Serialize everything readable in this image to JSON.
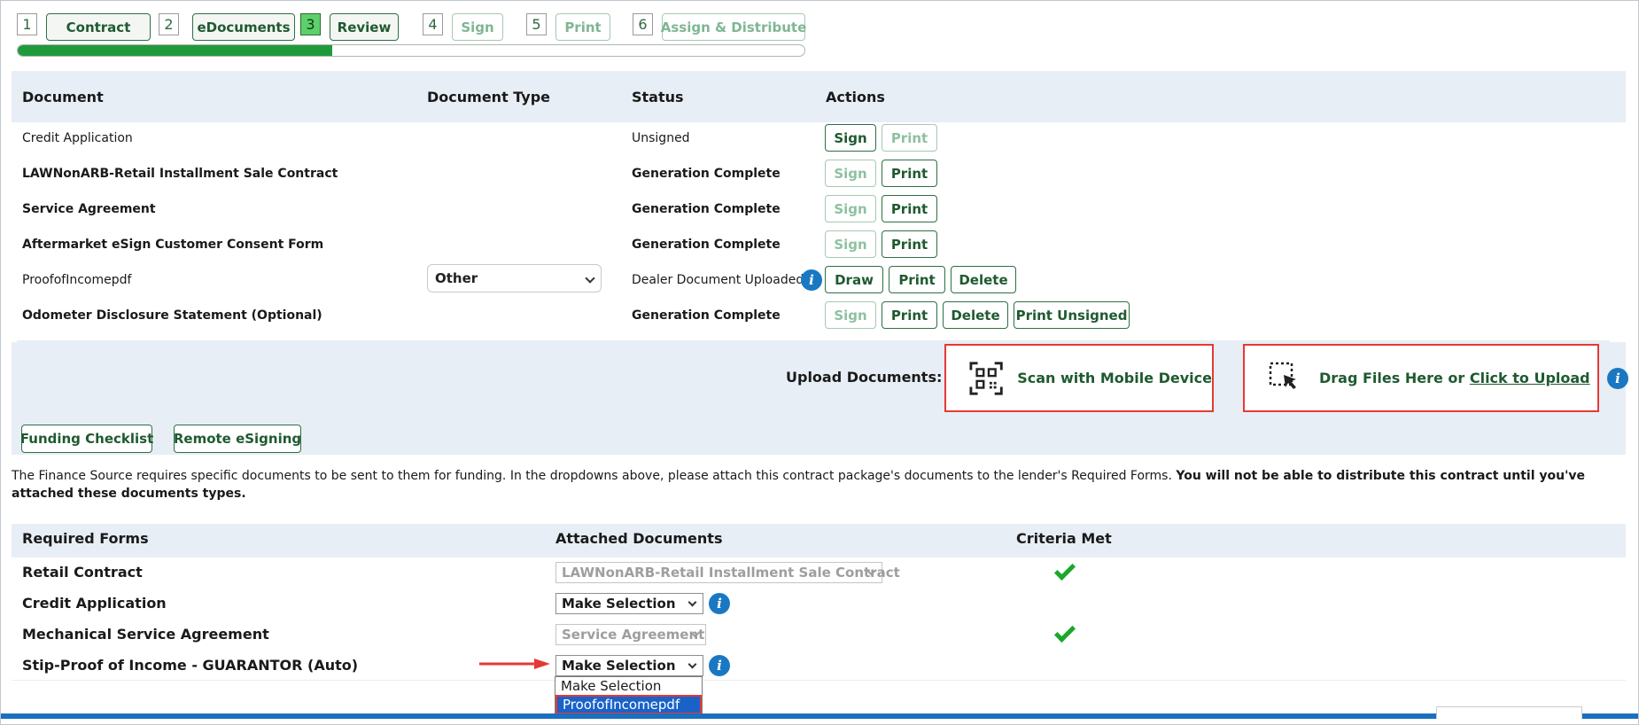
{
  "stepper": {
    "steps": [
      {
        "num": "1",
        "label": "Contract"
      },
      {
        "num": "2",
        "label": "eDocuments"
      },
      {
        "num": "3",
        "label": "Review"
      },
      {
        "num": "4",
        "label": "Sign"
      },
      {
        "num": "5",
        "label": "Print"
      },
      {
        "num": "6",
        "label": "Assign & Distribute"
      }
    ],
    "current_step": "3",
    "progress_fraction": 0.4
  },
  "documents": {
    "headers": {
      "document": "Document",
      "type": "Document Type",
      "status": "Status",
      "actions": "Actions"
    },
    "rows": [
      {
        "name": "Credit Application",
        "status": "Unsigned",
        "actions": [
          "Sign",
          "Print"
        ]
      },
      {
        "name": "LAWNonARB-Retail Installment Sale Contract",
        "status": "Generation Complete",
        "actions": [
          "Sign",
          "Print"
        ]
      },
      {
        "name": "Service Agreement",
        "status": "Generation Complete",
        "actions": [
          "Sign",
          "Print"
        ]
      },
      {
        "name": "Aftermarket eSign Customer Consent Form",
        "status": "Generation Complete",
        "actions": [
          "Sign",
          "Print"
        ]
      },
      {
        "name": "ProofofIncomepdf",
        "type": "Other",
        "status": "Dealer Document Uploaded",
        "actions": [
          "Draw",
          "Print",
          "Delete"
        ]
      },
      {
        "name": "Odometer Disclosure Statement (Optional)",
        "status": "Generation Complete",
        "actions": [
          "Sign",
          "Print",
          "Delete",
          "Print Unsigned"
        ]
      }
    ]
  },
  "upload": {
    "label": "Upload Documents:",
    "scan_label": "Scan with Mobile Device",
    "drag_label": "Drag Files Here or ",
    "click_label": "Click to Upload"
  },
  "buttons": {
    "funding_checklist": "Funding Checklist",
    "remote_esigning": "Remote eSigning"
  },
  "notice": {
    "text": "The Finance Source requires specific documents to be sent to them for funding. In the dropdowns above, please attach this contract package's documents to the lender's Required Forms. ",
    "bold": "You will not be able to distribute this contract until you've attached these documents types."
  },
  "required": {
    "headers": {
      "forms": "Required Forms",
      "attached": "Attached Documents",
      "criteria": "Criteria Met"
    },
    "rows": [
      {
        "name": "Retail Contract",
        "attached": "LAWNonARB-Retail Installment Sale Contract",
        "met": true
      },
      {
        "name": "Credit Application",
        "attached": "Make Selection",
        "met": false
      },
      {
        "name": "Mechanical Service Agreement",
        "attached": "Service Agreement",
        "met": true
      },
      {
        "name": "Stip-Proof of Income - GUARANTOR (Auto)",
        "attached": "Make Selection",
        "met": false
      }
    ]
  },
  "dropdown": {
    "options": [
      "Make Selection",
      "ProofofIncomepdf"
    ],
    "highlighted": "ProofofIncomepdf"
  },
  "colors": {
    "accent_green": "#1f5a30",
    "progress": "#1f9a3b",
    "highlight_red": "#e53935",
    "info_blue": "#1a78c2"
  }
}
